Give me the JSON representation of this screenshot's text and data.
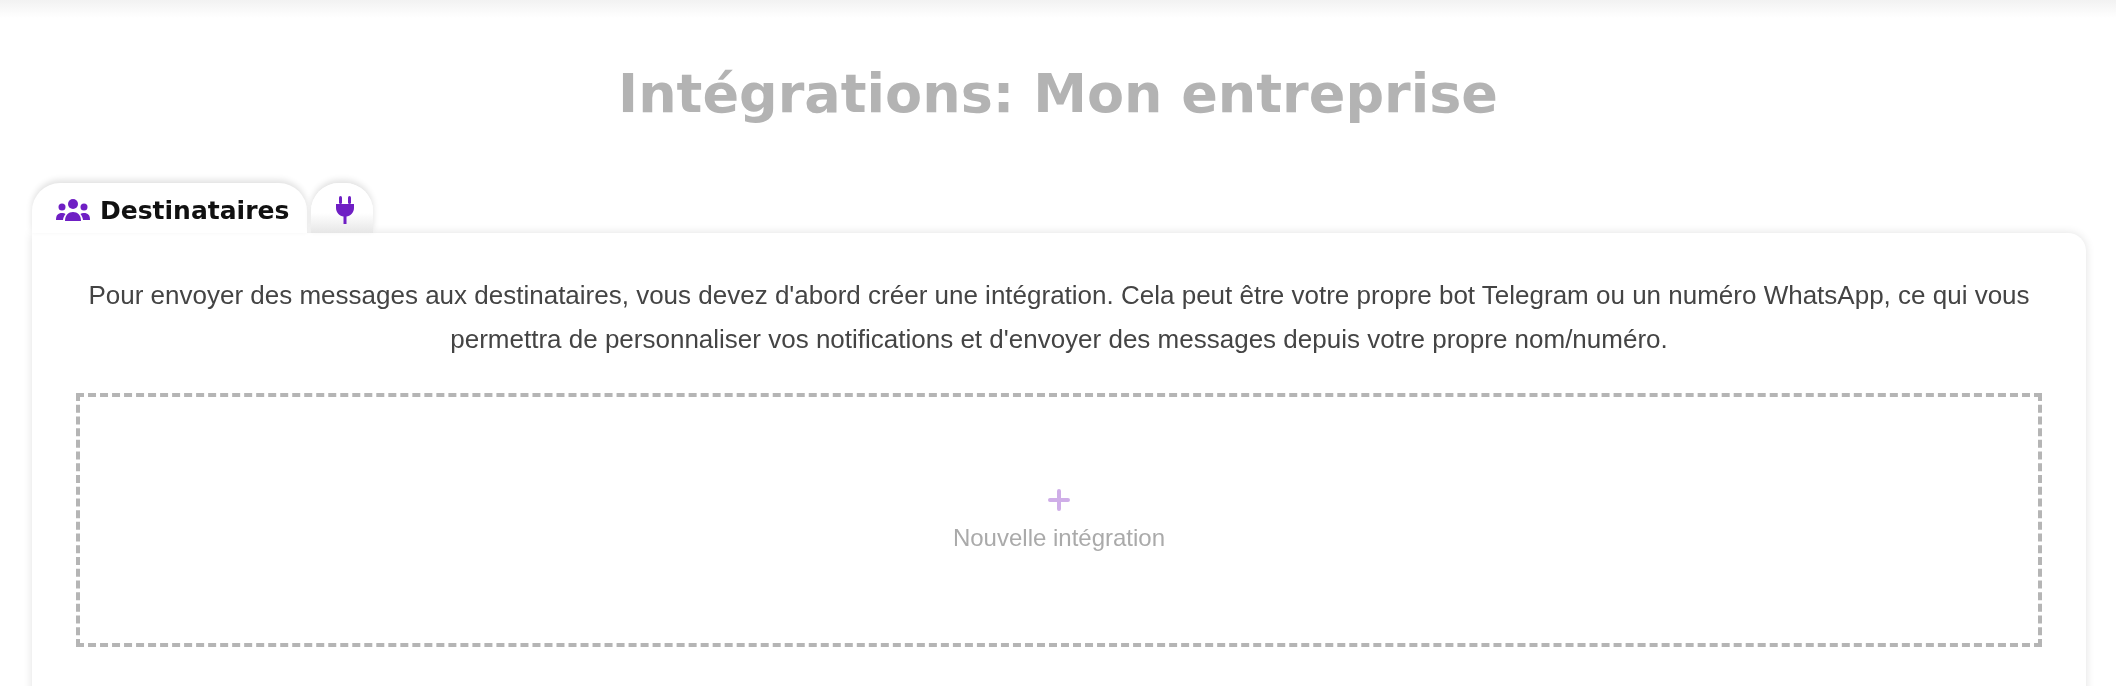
{
  "title": "Intégrations: Mon entreprise",
  "tabs": [
    {
      "label": "Destinataires",
      "kind": "people",
      "selected": true
    },
    {
      "kind": "plug",
      "selected": false
    }
  ],
  "description": "Pour envoyer des messages aux destinataires, vous devez d'abord créer une intégration. Cela peut être votre propre bot Telegram ou un numéro WhatsApp, ce qui vous permettra de personnaliser vos notifications et d'envoyer des messages depuis votre propre nom/numéro.",
  "add_button": {
    "label": "Nouvelle intégration"
  }
}
